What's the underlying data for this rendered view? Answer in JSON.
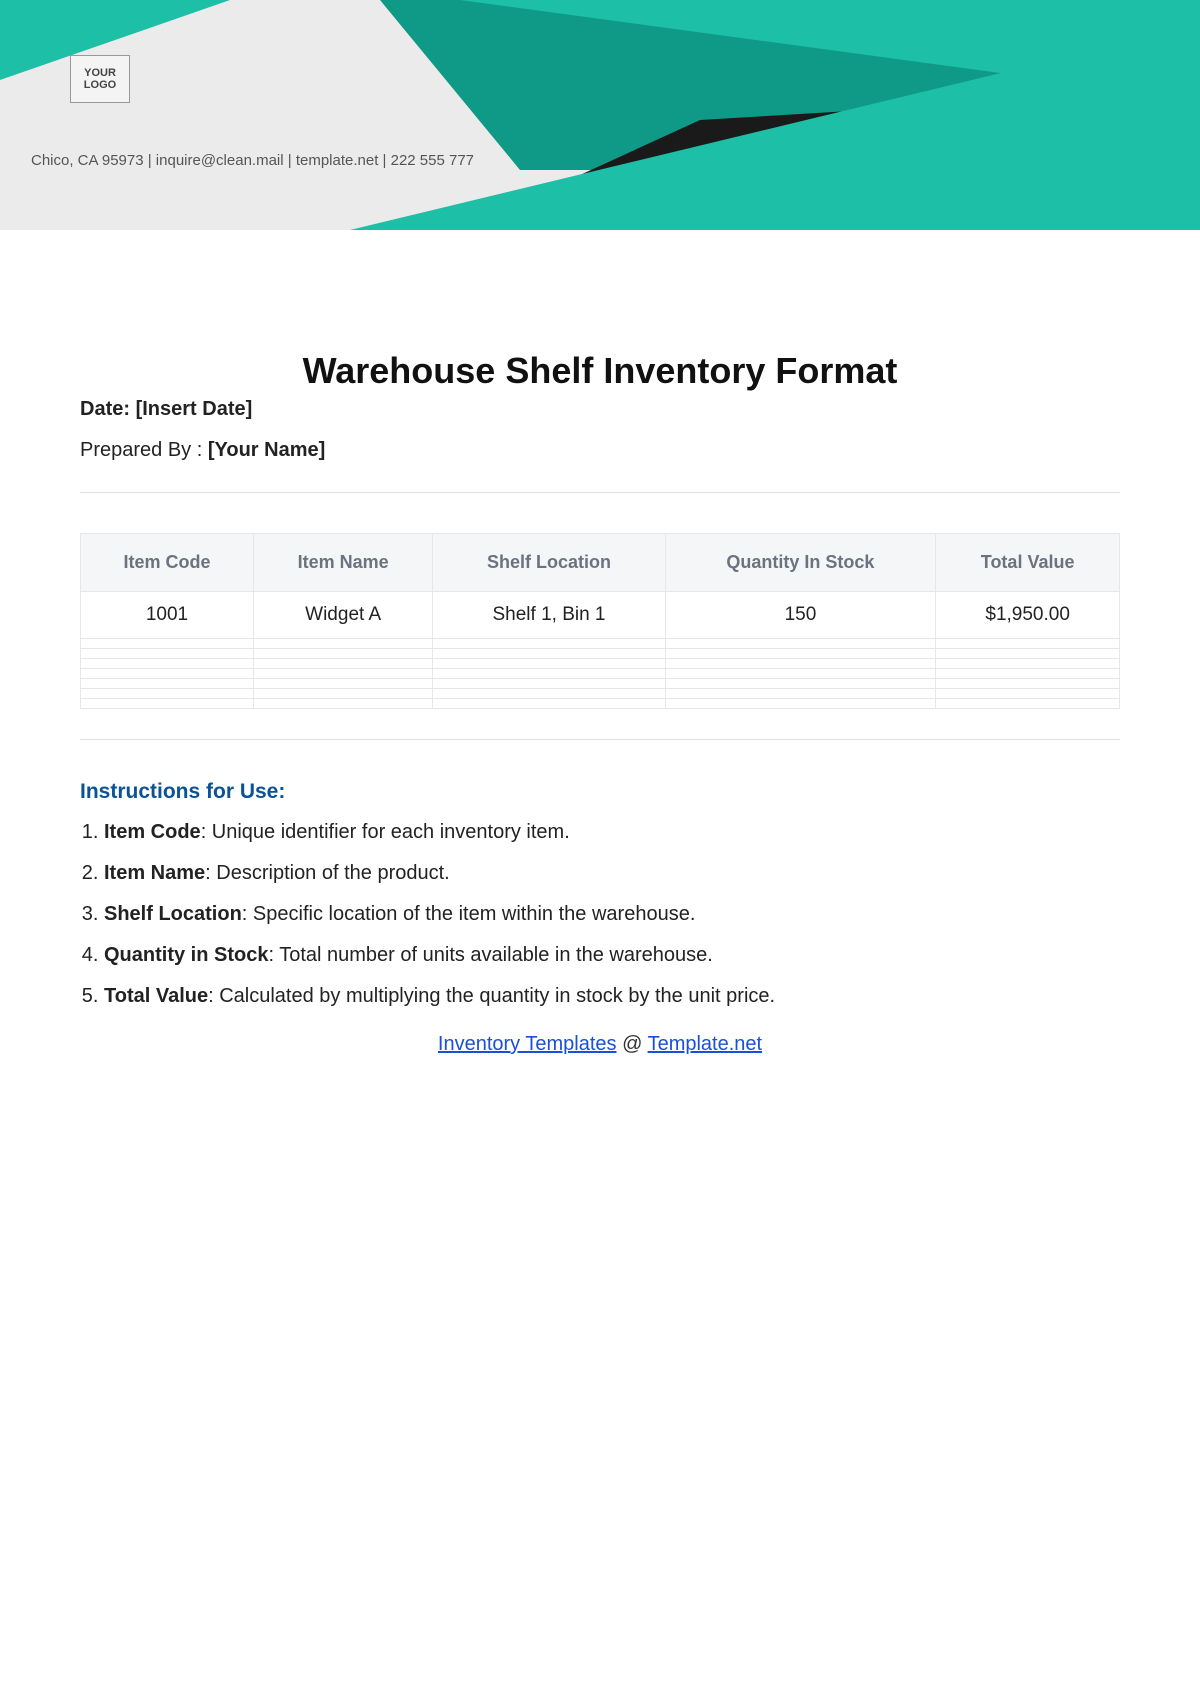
{
  "header": {
    "logo_text": "YOUR LOGO",
    "contact_line": "Chico, CA 95973 | inquire@clean.mail | template.net | 222 555 777"
  },
  "title": "Warehouse Shelf Inventory Format",
  "meta": {
    "date_label": "Date:",
    "date_value": "[Insert Date]",
    "prepared_label": "Prepared By :",
    "prepared_value": "[Your Name]"
  },
  "table": {
    "headers": [
      "Item Code",
      "Item Name",
      "Shelf Location",
      "Quantity In Stock",
      "Total Value"
    ],
    "rows": [
      {
        "item_code": "1001",
        "item_name": "Widget A",
        "shelf_location": "Shelf 1, Bin 1",
        "quantity": "150",
        "total_value": "$1,950.00"
      }
    ],
    "empty_row_count": 7
  },
  "instructions": {
    "title": "Instructions for Use:",
    "items": [
      {
        "term": "Item Code",
        "desc": ": Unique identifier for each inventory item."
      },
      {
        "term": "Item Name",
        "desc": ": Description of the product."
      },
      {
        "term": "Shelf Location",
        "desc": ": Specific location of the item within the warehouse."
      },
      {
        "term": "Quantity in Stock",
        "desc": ": Total number of units available in the warehouse."
      },
      {
        "term": "Total Value",
        "desc": ": Calculated by multiplying the quantity in stock by the unit price."
      }
    ]
  },
  "footer": {
    "link1_text": "Inventory Templates",
    "middle": " @ ",
    "link2_text": "Template.net"
  },
  "colors": {
    "accent_teal": "#1dbfa6",
    "accent_teal_dark": "#0f9a87",
    "black_stripe": "#1a1a1a",
    "header_bg": "#ebebeb"
  }
}
